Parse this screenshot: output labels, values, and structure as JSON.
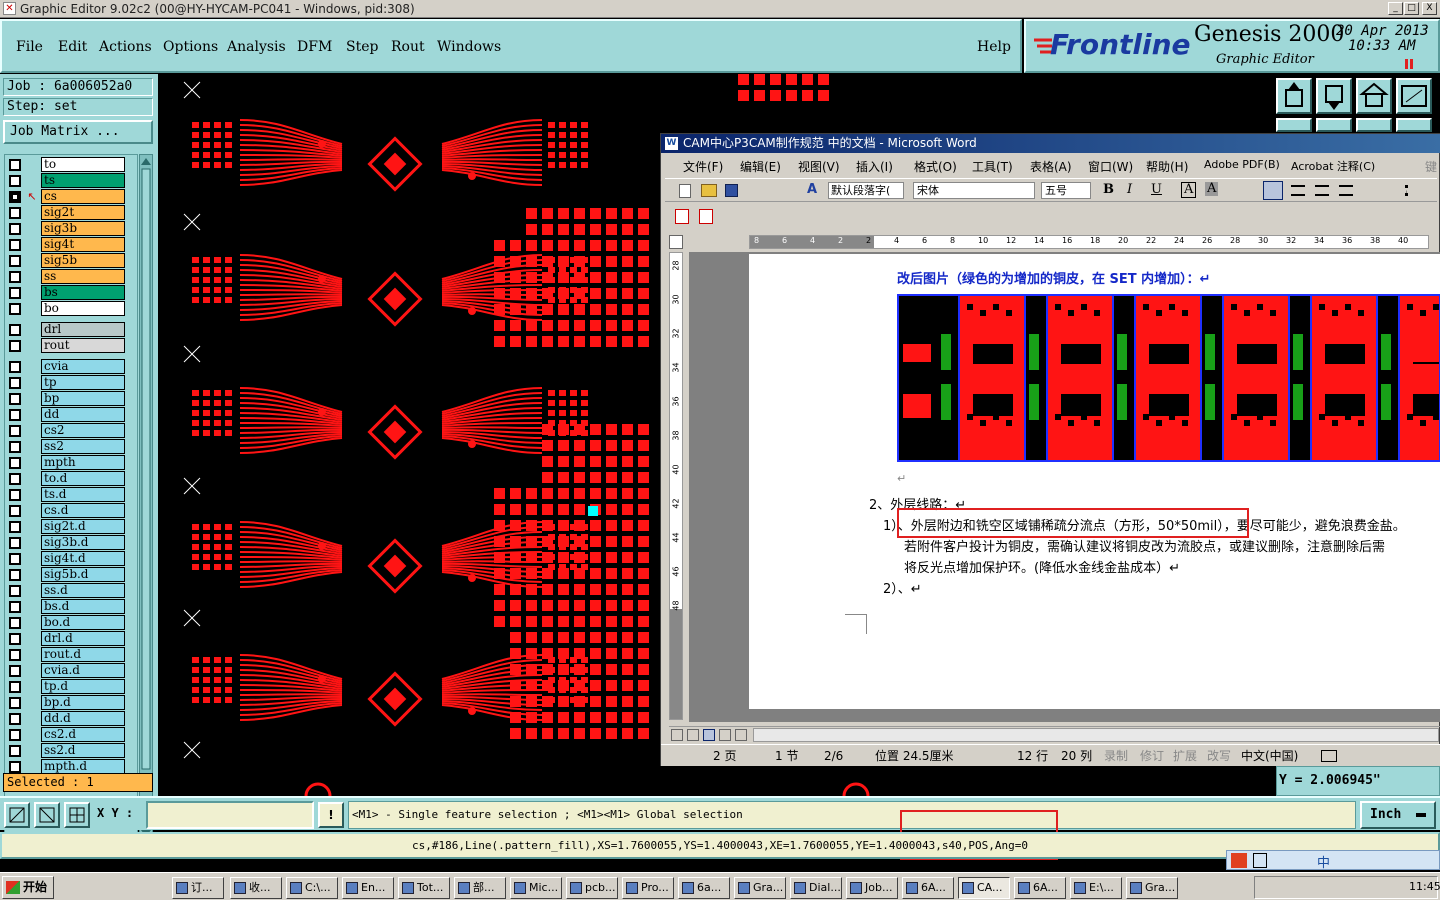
{
  "window": {
    "title": "Graphic Editor 9.02c2 (00@HY-HYCAM-PC041 - Windows, pid:308)",
    "controls": [
      "_",
      "□",
      "X"
    ]
  },
  "menu": {
    "items": [
      "File",
      "Edit",
      "Actions",
      "Options",
      "Analysis",
      "DFM",
      "Step",
      "Rout",
      "Windows"
    ],
    "help": "Help"
  },
  "branding": {
    "logo": "Frontline",
    "product": "Genesis 2000",
    "subtitle": "Graphic Editor",
    "date": "20 Apr 2013",
    "time": "10:33 AM"
  },
  "job": {
    "job_label": "Job  :  6a006052a0",
    "step_label": "Step:  set",
    "matrix_button": "Job Matrix ..."
  },
  "layers": [
    {
      "name": "to",
      "color": "#ffffff",
      "on": false
    },
    {
      "name": "ts",
      "color": "#00a070",
      "on": false
    },
    {
      "name": "cs",
      "color": "#ffb84d",
      "on": true
    },
    {
      "name": "sig2t",
      "color": "#ffb84d",
      "on": false
    },
    {
      "name": "sig3b",
      "color": "#ffb84d",
      "on": false
    },
    {
      "name": "sig4t",
      "color": "#ffb84d",
      "on": false
    },
    {
      "name": "sig5b",
      "color": "#ffb84d",
      "on": false
    },
    {
      "name": "ss",
      "color": "#ffb84d",
      "on": false
    },
    {
      "name": "bs",
      "color": "#00a070",
      "on": false
    },
    {
      "name": "bo",
      "color": "#ffffff",
      "on": false
    },
    {
      "name": "drl",
      "color": "#b8c8c8",
      "on": false
    },
    {
      "name": "rout",
      "color": "#d8d8d8",
      "on": false
    },
    {
      "name": "cvia",
      "color": "#8fd8e8",
      "on": false
    },
    {
      "name": "tp",
      "color": "#8fd8e8",
      "on": false
    },
    {
      "name": "bp",
      "color": "#8fd8e8",
      "on": false
    },
    {
      "name": "dd",
      "color": "#8fd8e8",
      "on": false
    },
    {
      "name": "cs2",
      "color": "#8fd8e8",
      "on": false
    },
    {
      "name": "ss2",
      "color": "#8fd8e8",
      "on": false
    },
    {
      "name": "mpth",
      "color": "#8fd8e8",
      "on": false
    },
    {
      "name": "to.d",
      "color": "#8fd8e8",
      "on": false
    },
    {
      "name": "ts.d",
      "color": "#8fd8e8",
      "on": false
    },
    {
      "name": "cs.d",
      "color": "#8fd8e8",
      "on": false
    },
    {
      "name": "sig2t.d",
      "color": "#8fd8e8",
      "on": false
    },
    {
      "name": "sig3b.d",
      "color": "#8fd8e8",
      "on": false
    },
    {
      "name": "sig4t.d",
      "color": "#8fd8e8",
      "on": false
    },
    {
      "name": "sig5b.d",
      "color": "#8fd8e8",
      "on": false
    },
    {
      "name": "ss.d",
      "color": "#8fd8e8",
      "on": false
    },
    {
      "name": "bs.d",
      "color": "#8fd8e8",
      "on": false
    },
    {
      "name": "bo.d",
      "color": "#8fd8e8",
      "on": false
    },
    {
      "name": "drl.d",
      "color": "#8fd8e8",
      "on": false
    },
    {
      "name": "rout.d",
      "color": "#8fd8e8",
      "on": false
    },
    {
      "name": "cvia.d",
      "color": "#8fd8e8",
      "on": false
    },
    {
      "name": "tp.d",
      "color": "#8fd8e8",
      "on": false
    },
    {
      "name": "bp.d",
      "color": "#8fd8e8",
      "on": false
    },
    {
      "name": "dd.d",
      "color": "#8fd8e8",
      "on": false
    },
    {
      "name": "cs2.d",
      "color": "#8fd8e8",
      "on": false
    },
    {
      "name": "ss2.d",
      "color": "#8fd8e8",
      "on": false
    },
    {
      "name": "mpth.d",
      "color": "#8fd8e8",
      "on": false
    }
  ],
  "selected": "Selected : 1",
  "coords": {
    "y": "Y  = 2.006945\""
  },
  "command": {
    "xy_label": "X Y :",
    "xy_value": "",
    "hint": "<M1> - Single feature selection ; <M1><M1> Global selection",
    "units": "Inch"
  },
  "status_line": "cs,#186,Line(.pattern_fill),XS=1.7600055,YS=1.4000043,XE=1.7600055,YE=1.4000043,s40,POS,Ang=0",
  "word": {
    "title": "CAM中心P3CAM制作规范 中的文档 - Microsoft Word",
    "menus": [
      "文件(F)",
      "编辑(E)",
      "视图(V)",
      "插入(I)",
      "格式(O)",
      "工具(T)",
      "表格(A)",
      "窗口(W)",
      "帮助(H)",
      "Adobe PDF(B)",
      "Acrobat 注释(C)",
      "键"
    ],
    "style": "默认段落字(",
    "font": "宋体",
    "size": "五号",
    "format_buttons": [
      "B",
      "I",
      "U",
      "A",
      "A"
    ],
    "ruler_ticks": [
      "8",
      "6",
      "4",
      "2",
      "2",
      "4",
      "6",
      "8",
      "10",
      "12",
      "14",
      "16",
      "18",
      "20",
      "22",
      "24",
      "26",
      "28",
      "30",
      "32",
      "34",
      "36",
      "38",
      "40"
    ],
    "vruler_ticks": [
      "28",
      "30",
      "32",
      "34",
      "36",
      "38",
      "40",
      "42",
      "44",
      "46",
      "48"
    ],
    "heading": "改后图片（绿色的为增加的铜皮，在 SET 内增加）：↵",
    "para_mark": "↵",
    "section": "2、外层线路：↵",
    "item1_a": "1）、外层附边和铣空区域铺稀疏分流点（方形，50*50mil），要尽可能少，避免浪费金盐。",
    "item1_b": "若附件客户投计为铜皮，需确认建议将铜皮改为流胶点，或建议删除，注意删除后需",
    "item1_c": "将反光点增加保护环。(降低水金线金盐成本）↵",
    "item2": "2）、↵",
    "status": {
      "page": "2 页",
      "section": "1 节",
      "pages": "2/6",
      "position": "位置 24.5厘米",
      "line": "12 行",
      "col": "20 列",
      "rec": "录制",
      "trk": "修订",
      "ext": "扩展",
      "ovr": "改写",
      "lang": "中文(中国)"
    }
  },
  "taskbar": {
    "start": "开始",
    "tasks": [
      "订...",
      "收...",
      "C:\\...",
      "En...",
      "Tot...",
      "部...",
      "Mic...",
      "pcb...",
      "Pro...",
      "6a...",
      "Gra...",
      "Dial...",
      "Job...",
      "6A...",
      "CA...",
      "6A...",
      "E:\\...",
      "Gra..."
    ],
    "clock": "11:45"
  }
}
